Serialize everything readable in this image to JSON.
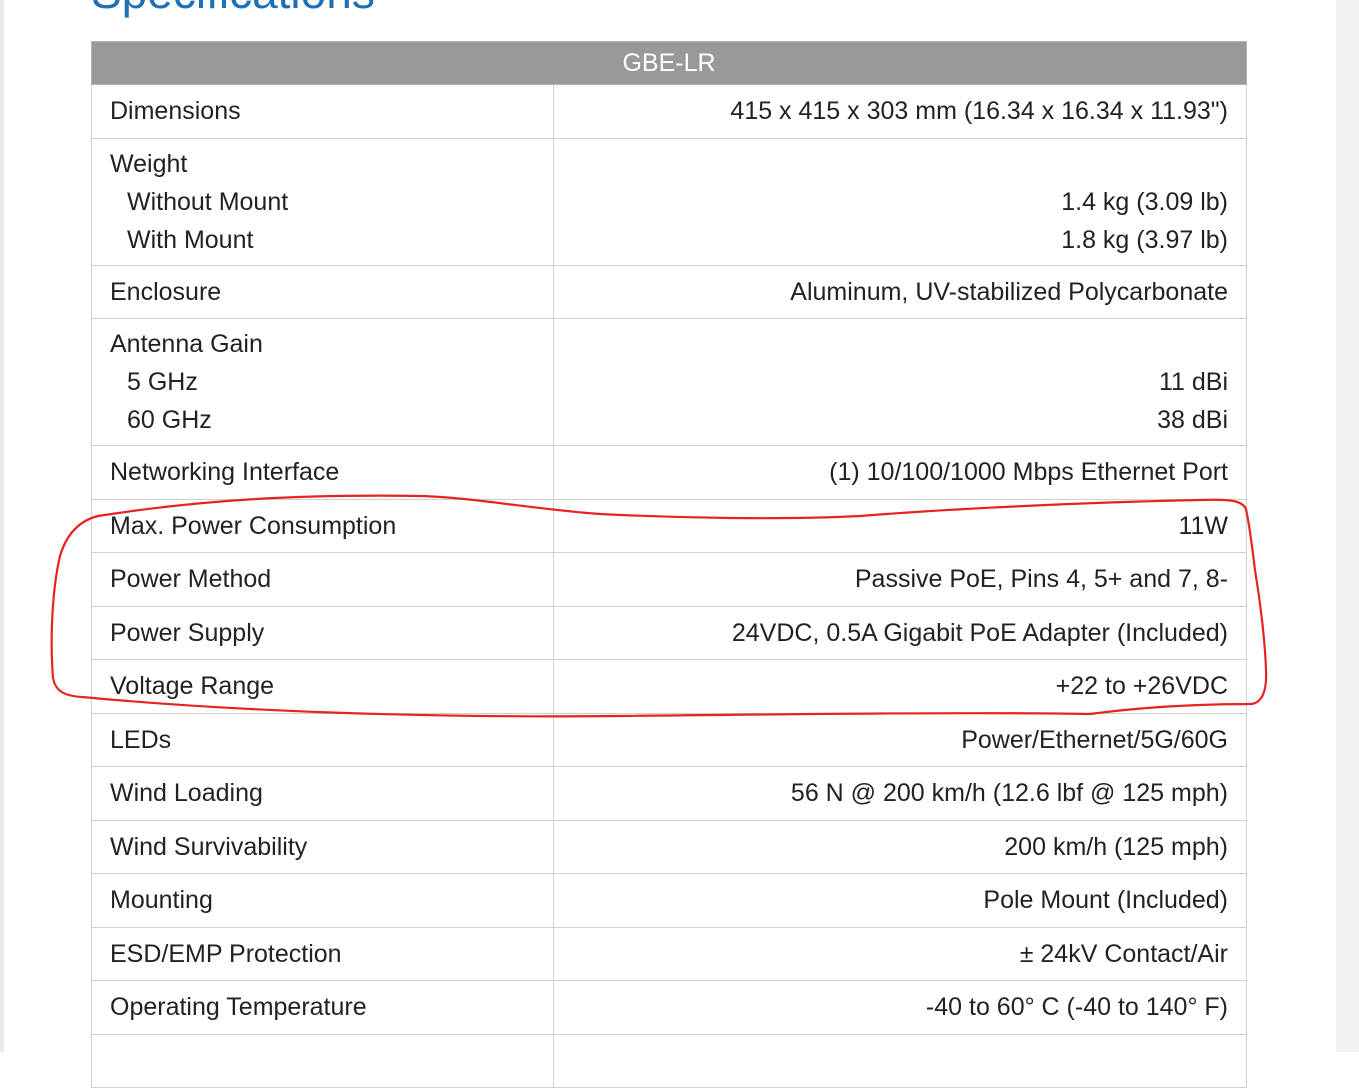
{
  "page": {
    "heading": "Specifications"
  },
  "table": {
    "header": "GBE-LR",
    "rows": [
      {
        "label": "Dimensions",
        "value": "415 x 415 x 303 mm (16.34 x 16.34 x 11.93\")"
      },
      {
        "label": "Weight",
        "sub": [
          {
            "label": "Without Mount",
            "value": "1.4 kg (3.09 lb)"
          },
          {
            "label": "With Mount",
            "value": "1.8 kg (3.97 lb)"
          }
        ]
      },
      {
        "label": "Enclosure",
        "value": "Aluminum, UV-stabilized Polycarbonate"
      },
      {
        "label": "Antenna Gain",
        "sub": [
          {
            "label": "5 GHz",
            "value": "11 dBi"
          },
          {
            "label": "60 GHz",
            "value": "38 dBi"
          }
        ]
      },
      {
        "label": "Networking Interface",
        "value": "(1) 10/100/1000 Mbps Ethernet Port"
      },
      {
        "label": "Max. Power Consumption",
        "value": "11W"
      },
      {
        "label": "Power Method",
        "value": "Passive PoE, Pins 4, 5+ and 7, 8-"
      },
      {
        "label": "Power Supply",
        "value": "24VDC, 0.5A Gigabit PoE Adapter (Included)"
      },
      {
        "label": "Voltage Range",
        "value": "+22 to +26VDC"
      },
      {
        "label": "LEDs",
        "value": "Power/Ethernet/5G/60G"
      },
      {
        "label": "Wind Loading",
        "value": "56 N @ 200 km/h (12.6 lbf @ 125 mph)"
      },
      {
        "label": "Wind Survivability",
        "value": "200 km/h (125 mph)"
      },
      {
        "label": "Mounting",
        "value": "Pole Mount (Included)"
      },
      {
        "label": "ESD/EMP Protection",
        "value": "± 24kV Contact/Air"
      },
      {
        "label": "Operating Temperature",
        "value": "-40 to 60° C (-40 to 140° F)"
      }
    ]
  },
  "annotation": {
    "color": "#e8231f"
  },
  "colors": {
    "heading": "#1f6fb5",
    "header_bg": "#999999",
    "border": "#cfcfcf",
    "text": "#222222"
  }
}
